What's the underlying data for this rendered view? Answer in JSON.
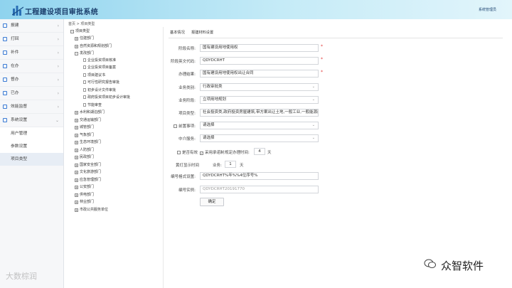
{
  "header": {
    "title": "工程建设项目审批系统",
    "user": "系统管理员"
  },
  "sidebar": {
    "items": [
      {
        "label": "报建",
        "chevron": "›"
      },
      {
        "label": "打回",
        "chevron": "›"
      },
      {
        "label": "补件",
        "chevron": "›"
      },
      {
        "label": "在办",
        "chevron": "›"
      },
      {
        "label": "督办",
        "chevron": "›"
      },
      {
        "label": "已办",
        "chevron": "›"
      },
      {
        "label": "效能监督",
        "chevron": "›"
      },
      {
        "label": "系统设置",
        "chevron": "⌄"
      }
    ],
    "sub_items": [
      {
        "label": "用户管理"
      },
      {
        "label": "参数设置"
      },
      {
        "label": "项目类型"
      }
    ]
  },
  "breadcrumb": {
    "home": "首页",
    "sep": ">",
    "current": "项目类型"
  },
  "tree": {
    "nodes": [
      {
        "label": "项目类型",
        "box": "-"
      },
      {
        "label": "住建部门",
        "box": "+"
      },
      {
        "label": "自然资源和规划部门",
        "box": "+"
      },
      {
        "label": "发改部门",
        "box": "-"
      },
      {
        "label": "企业投资项目核准"
      },
      {
        "label": "企业投资项目备案"
      },
      {
        "label": "项目建议书"
      },
      {
        "label": "可行性研究报告审批"
      },
      {
        "label": "初步设计文件审批"
      },
      {
        "label": "政府投资项目初步设计审批"
      },
      {
        "label": "节能审查"
      },
      {
        "label": "水利和湖泊部门",
        "box": "+"
      },
      {
        "label": "交通运输部门",
        "box": "+"
      },
      {
        "label": "城管部门",
        "box": "+"
      },
      {
        "label": "气象部门",
        "box": "+"
      },
      {
        "label": "生态环境部门",
        "box": "+"
      },
      {
        "label": "人防部门",
        "box": "+"
      },
      {
        "label": "民政部门",
        "box": "+"
      },
      {
        "label": "国家安全部门",
        "box": "+"
      },
      {
        "label": "文化旅游部门",
        "box": "+"
      },
      {
        "label": "应急管理部门",
        "box": "+"
      },
      {
        "label": "公安部门",
        "box": "+"
      },
      {
        "label": "供电部门",
        "box": "+"
      },
      {
        "label": "林业部门",
        "box": "+"
      },
      {
        "label": "市政公共服务单位",
        "box": "+"
      }
    ]
  },
  "tabs": {
    "basic": "基本情况",
    "materials": "报建材料设置"
  },
  "form": {
    "stage_name": {
      "label": "阶段名称:",
      "value": "国有建设用地使用权"
    },
    "stage_code": {
      "label": "阶段英文代码:",
      "value": "QDYDCRHT"
    },
    "result": {
      "label": "办理结果:",
      "value": "国有建设用地使用权出让合同"
    },
    "biz_type": {
      "label": "业务类别:",
      "value": "行政审批类"
    },
    "biz_stage": {
      "label": "业务阶段:",
      "value": "立项用地规划"
    },
    "project_type": {
      "label": "项目类型:",
      "value": "社会投资类,政府投资房屋建筑,带方案出让土地,一般工业,一般能源建设"
    },
    "pre_item": {
      "label": "前置事项:",
      "value": "请选择"
    },
    "agency": {
      "label": "中介服务:",
      "value": "请选择"
    },
    "annual": {
      "label": "是否有效",
      "countdown_label": "采用承诺制",
      "time_label": "规定办理时间:",
      "time_value": "4",
      "unit": "天"
    },
    "reminder": {
      "label": "黄灯显示时间",
      "workday_label": "业务:",
      "value": "1",
      "unit": "天"
    },
    "code_format": {
      "label": "编号格式设置:",
      "value": "QDYDCRHT%年%%4位序号%"
    },
    "code_example": {
      "label": "编号实例:",
      "value": "QDYDCRHT20191770"
    },
    "confirm_label": "确定",
    "required_mark": "*",
    "dropdown_mark": "⌄",
    "checkmark": "✓"
  },
  "watermarks": {
    "left": "大数棕润",
    "right": "众智软件"
  },
  "colors": {
    "header_start": "#8fd3ee",
    "accent": "#3a7bd5",
    "required": "#e23b3b"
  }
}
